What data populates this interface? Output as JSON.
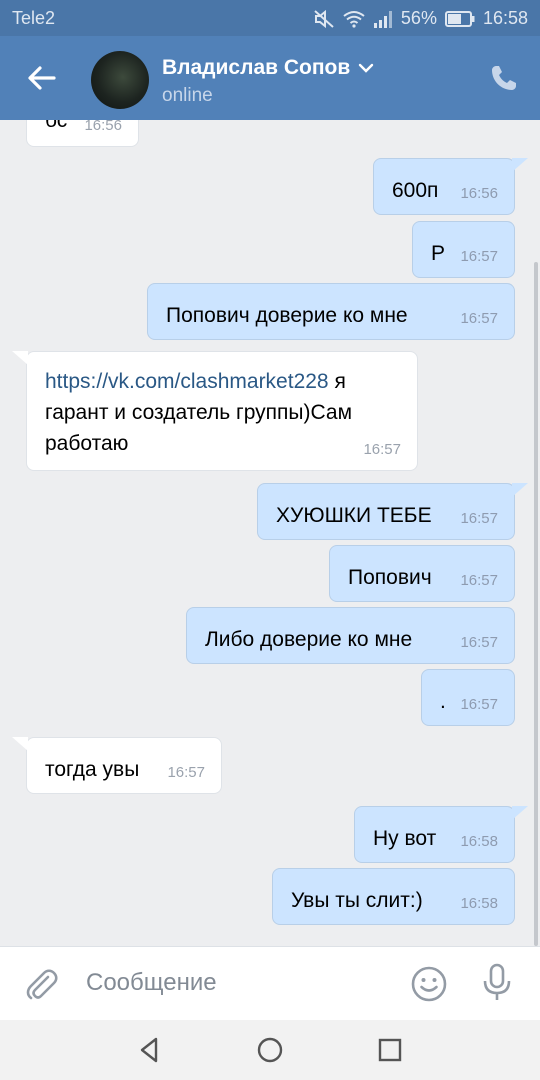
{
  "status_bar": {
    "carrier": "Tele2",
    "battery": "56%",
    "time": "16:58"
  },
  "header": {
    "name": "Владислав Сопов",
    "status": "online"
  },
  "messages": [
    {
      "dir": "in",
      "text": "бс",
      "time": "16:56"
    },
    {
      "dir": "out",
      "text": "600п",
      "time": "16:56"
    },
    {
      "dir": "out",
      "text": "Р",
      "time": "16:57"
    },
    {
      "dir": "out",
      "text": "Попович доверие ко мне",
      "time": "16:57"
    },
    {
      "dir": "in",
      "link": "https://vk.com/clashmarket228",
      "text_after_link": "я",
      "line2": "гарант и создатель группы)Сам",
      "line3": "работаю",
      "time": "16:57"
    },
    {
      "dir": "out",
      "text": "ХУЮШКИ ТЕБЕ",
      "time": "16:57"
    },
    {
      "dir": "out",
      "text": "Попович",
      "time": "16:57"
    },
    {
      "dir": "out",
      "text": "Либо доверие ко мне",
      "time": "16:57"
    },
    {
      "dir": "out",
      "text": ".",
      "time": "16:57"
    },
    {
      "dir": "in",
      "text": "тогда увы",
      "time": "16:57"
    },
    {
      "dir": "out",
      "text": "Ну вот",
      "time": "16:58"
    },
    {
      "dir": "out",
      "text": "Увы ты слит:)",
      "time": "16:58"
    }
  ],
  "composer": {
    "placeholder": "Сообщение"
  },
  "colors": {
    "header": "#5181b8",
    "status_bar": "#4a76a8",
    "outgoing_bubble": "#cce4ff",
    "incoming_bubble": "#ffffff",
    "background": "#edeef0",
    "link": "#2a5885"
  },
  "icons": [
    "back-arrow-icon",
    "phone-icon",
    "chevron-down-icon",
    "attach-icon",
    "emoji-icon",
    "mic-icon",
    "nav-back-icon",
    "nav-home-icon",
    "nav-recents-icon",
    "wifi-icon",
    "mute-icon",
    "signal-icon",
    "battery-icon"
  ]
}
